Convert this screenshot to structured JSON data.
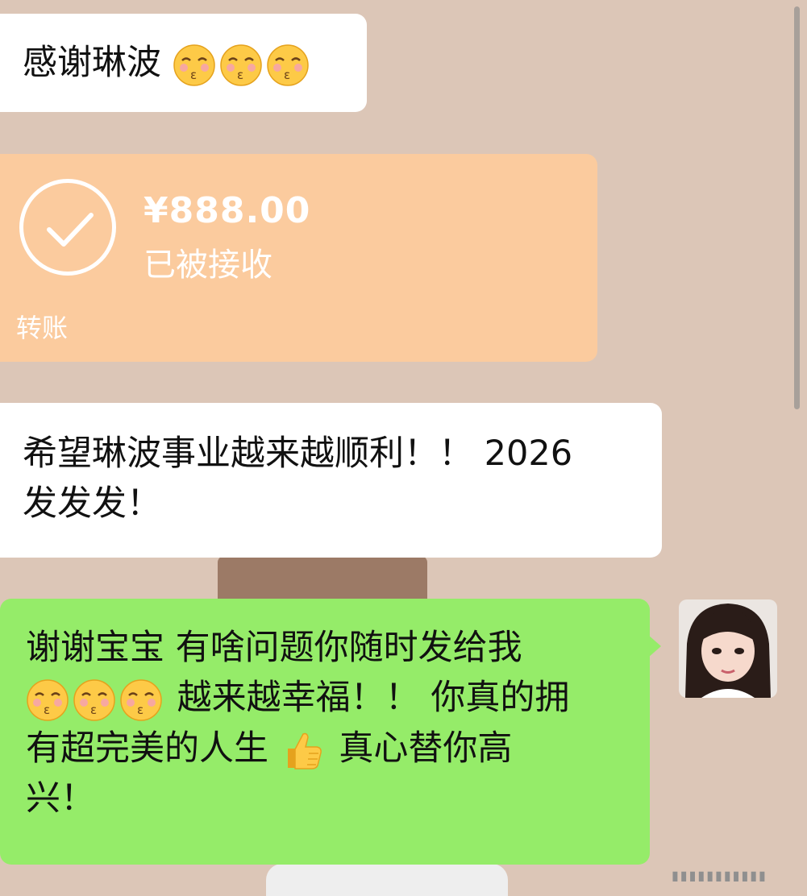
{
  "messages": {
    "thanks": {
      "text": "感谢琳波",
      "emoji_count": 3,
      "emoji_icon": "kissing-smiling-eyes-emoji"
    },
    "transfer": {
      "amount": "¥888.00",
      "status": "已被接收",
      "type_label": "转账",
      "icon": "check-circle-icon",
      "color": "#fbcb9e"
    },
    "wish": {
      "line1": "希望琳波事业越来越顺利！！ 2026",
      "line2": "发发发！"
    },
    "reply": {
      "line1": "谢谢宝宝 有啥问题你随时发给我",
      "line2_text": "越来越幸福！！ 你真的拥",
      "line3_a": "有超完美的人生",
      "line3_b": "真心替你高",
      "line4": "兴！",
      "emoji_icon": "kissing-smiling-eyes-emoji",
      "thumb_icon": "thumbs-up-emoji",
      "color": "#95ec69"
    }
  },
  "avatar": {
    "icon": "user-avatar-photo"
  }
}
